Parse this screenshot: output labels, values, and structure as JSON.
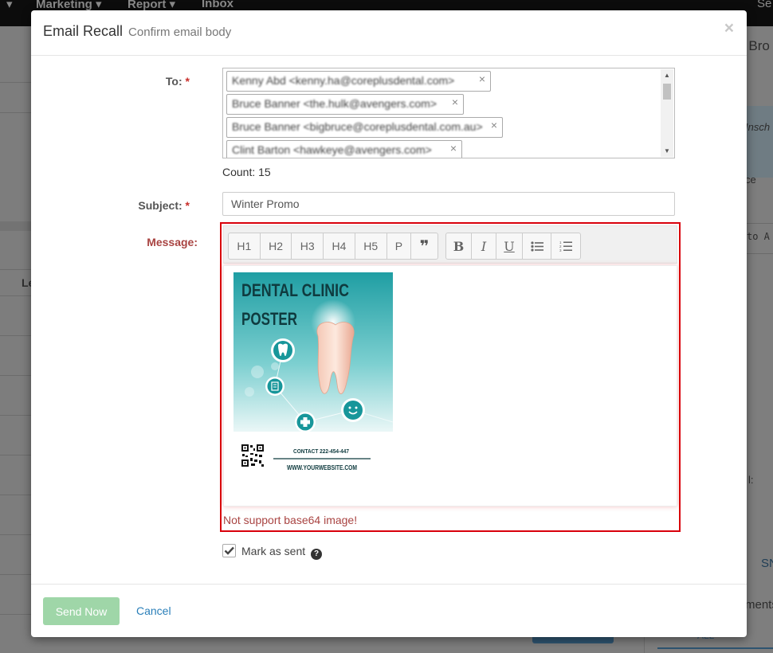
{
  "background": {
    "nav": {
      "marketing": "Marketing ▾",
      "report": "Report ▾",
      "inbox": "Inbox",
      "right": "Se"
    },
    "side": {
      "t1": "r Bro",
      "t2": "Insch",
      "t3": "ce",
      "t4": "to A",
      "t5": "l:",
      "t6": "SN",
      "t7": "ments",
      "t8": "ALL"
    },
    "main": {
      "col": "Le"
    }
  },
  "modal": {
    "title": "Email Recall",
    "subtitle": "Confirm email body",
    "close_label": "×"
  },
  "form": {
    "to_label": "To:",
    "required_mark": "*",
    "recipients": [
      {
        "text": "Kenny Abd <kenny.ha@coreplusdental.com>",
        "remove": "×"
      },
      {
        "text": "Bruce Banner <the.hulk@avengers.com>",
        "remove": "×"
      },
      {
        "text": "Bruce Banner <bigbruce@coreplusdental.com.au>",
        "remove": "×"
      },
      {
        "text": "Clint Barton <hawkeye@avengers.com>",
        "remove": "×"
      }
    ],
    "count_text": "Count: 15",
    "subject_label": "Subject:",
    "subject_value": "Winter Promo",
    "message_label": "Message:",
    "toolbar": {
      "h1": "H1",
      "h2": "H2",
      "h3": "H3",
      "h4": "H4",
      "h5": "H5",
      "p": "P",
      "quote": "❞",
      "bold": "B",
      "italic": "I",
      "underline": "U"
    },
    "poster": {
      "title_line1": "DENTAL CLINIC",
      "title_line2": "POSTER",
      "contact": "CONTACT 222-454-447",
      "website": "WWW.YOURWEBSITE.COM"
    },
    "error_text": "Not support base64 image!",
    "mark_as_sent_label": "Mark as sent",
    "help_glyph": "?"
  },
  "footer": {
    "send_label": "Send Now",
    "cancel_label": "Cancel"
  },
  "colors": {
    "error_border": "#d9000b",
    "error_text": "#a94442",
    "send_button": "#9fd6a8",
    "link": "#2a7fb9",
    "poster_teal": "#1fa3a3"
  }
}
